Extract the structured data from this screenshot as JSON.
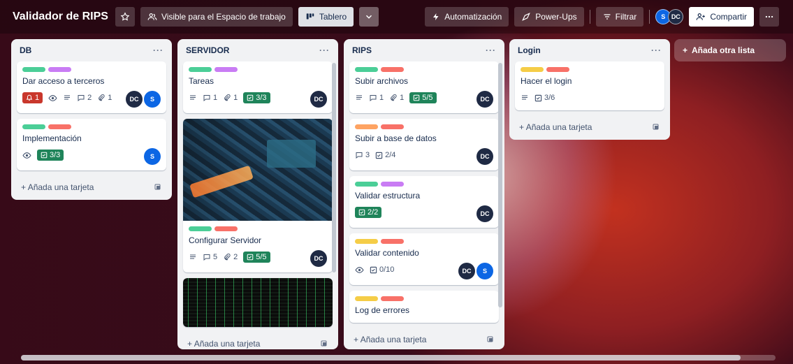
{
  "board": {
    "title": "Validador de RIPS",
    "visibility_label": "Visible para el Espacio de trabajo",
    "view_label": "Tablero",
    "automation_label": "Automatización",
    "powerups_label": "Power-Ups",
    "filter_label": "Filtrar",
    "share_label": "Compartir",
    "members": [
      "S",
      "DC"
    ]
  },
  "lists": [
    {
      "title": "DB",
      "cards": [
        {
          "title": "Dar acceso a terceros",
          "labels": [
            "#4bce97",
            "#c97cf4"
          ],
          "due_count": "1",
          "comments": "2",
          "attachments": "1",
          "members": [
            "DC",
            "S"
          ]
        },
        {
          "title": "Implementación",
          "labels": [
            "#4bce97",
            "#f87168"
          ],
          "checklist": "3/3",
          "members": [
            "S"
          ]
        }
      ],
      "add_card": "Añada una tarjeta"
    },
    {
      "title": "SERVIDOR",
      "cards": [
        {
          "title": "Tareas",
          "labels": [
            "#4bce97",
            "#c97cf4"
          ],
          "comments": "1",
          "attachments": "1",
          "checklist": "3/3",
          "members": [
            "DC"
          ]
        },
        {
          "title": "Configurar Servidor",
          "labels": [
            "#4bce97",
            "#f87168"
          ],
          "comments": "5",
          "attachments": "2",
          "checklist": "5/5",
          "members": [
            "DC"
          ]
        }
      ],
      "add_card": "Añada una tarjeta"
    },
    {
      "title": "RIPS",
      "cards": [
        {
          "title": "Subir archivos",
          "labels": [
            "#4bce97",
            "#f87168"
          ],
          "comments": "1",
          "attachments": "1",
          "checklist": "5/5",
          "members": [
            "DC"
          ]
        },
        {
          "title": "Subir a base de datos",
          "labels": [
            "#fea362",
            "#f87168"
          ],
          "comments": "3",
          "checklist": "2/4",
          "members": [
            "DC"
          ]
        },
        {
          "title": "Validar estructura",
          "labels": [
            "#4bce97",
            "#c97cf4"
          ],
          "checklist": "2/2",
          "members": [
            "DC"
          ]
        },
        {
          "title": "Validar contenido",
          "labels": [
            "#f5cd47",
            "#f87168"
          ],
          "checklist": "0/10",
          "members": [
            "DC",
            "S"
          ]
        },
        {
          "title": "Log de errores",
          "labels": [
            "#f5cd47",
            "#f87168"
          ]
        }
      ],
      "add_card": "Añada una tarjeta"
    },
    {
      "title": "Login",
      "cards": [
        {
          "title": "Hacer el login",
          "labels": [
            "#f5cd47",
            "#f87168"
          ],
          "checklist": "3/6"
        }
      ],
      "add_card": "Añada una tarjeta"
    }
  ],
  "add_list": "Añada otra lista",
  "icons": [
    "star-icon",
    "people-icon",
    "board-icon",
    "chevron-down-icon",
    "bolt-icon",
    "rocket-icon",
    "filter-icon",
    "share-icon",
    "more-icon",
    "eye-icon",
    "description-icon",
    "comment-icon",
    "attachment-icon",
    "checklist-icon",
    "plus-icon",
    "template-icon",
    "alarm-icon"
  ]
}
